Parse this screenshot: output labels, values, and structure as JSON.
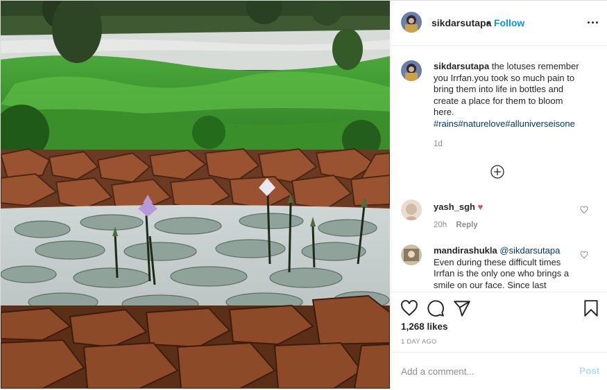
{
  "post": {
    "author": "sikdarsutapa",
    "header_dot": "•",
    "follow_label": "Follow",
    "more_icon": "more-options-icon"
  },
  "caption": {
    "user": "sikdarsutapa",
    "text": "the lotuses remember you Irrfan.you took so much pain to bring them into life in bottles and create a place for them to bloom here.",
    "tags": "#rains#naturelove#alluniverseisone",
    "time": "1d"
  },
  "comments": [
    {
      "user": "yash_sgh",
      "text": "",
      "emoji": "♥",
      "time": "20h",
      "reply_label": "Reply"
    },
    {
      "user": "mandirashukla",
      "mention": "@sikdarsutapa",
      "text": "Even during these difficult times Irrfan is the only one who brings a smile on our face. Since last"
    }
  ],
  "actions": {
    "likes": "1,268 likes",
    "time_ago": "1 DAY AGO",
    "comment_placeholder": "Add a comment...",
    "post_label": "Post"
  },
  "colors": {
    "link_blue": "#0095f6",
    "hashtag": "#00376b",
    "post_disabled": "#b2dffc",
    "heart_red": "#ed4956"
  }
}
